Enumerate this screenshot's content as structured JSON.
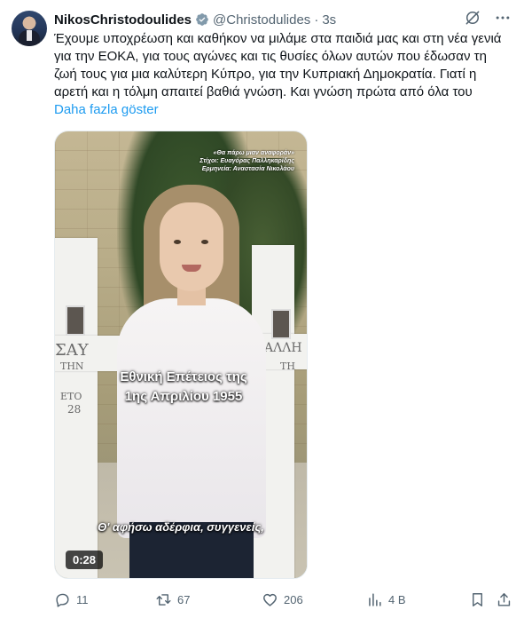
{
  "tweet": {
    "display_name": "NikosChristodoulides",
    "handle": "@Christodulides",
    "separator": "·",
    "time": "3s",
    "text_lines": [
      "Έχουμε υποχρέωση και καθήκον να μιλάμε στα παιδιά μας και στη νέα γενιά",
      "για την ΕΟΚΑ, για τους αγώνες και τις θυσίες όλων αυτών που έδωσαν τη",
      "ζωή τους για μια καλύτερη Κύπρο, για την Κυπριακή Δημοκρατία. Γιατί η",
      "αρετή και η τόλμη απαιτεί βαθιά γνώση. Και γνώση πρώτα από όλα του"
    ],
    "show_more": "Daha fazla göster"
  },
  "video": {
    "credits": [
      "«Θα πάρω μιαν αναφοράν»",
      "Στίχοι: Ευαγόρας Παλληκαρίδης",
      "Ερμηνεία: Αναστασία Νικολάου"
    ],
    "title_lines": [
      "Εθνική Επέτειος της",
      "1ης Απριλίου 1955"
    ],
    "subtitle": "Θ' αφήσω αδέρφια, συγγενείς,",
    "duration": "0:28",
    "cross_text_left": [
      "ΣΑΥ",
      "ΤΗΝ",
      "ΕΤΟ",
      "28"
    ],
    "cross_text_right": [
      "ΑΛΛΗ",
      "ΤΗ"
    ]
  },
  "actions": {
    "replies": "11",
    "reposts": "67",
    "likes": "206",
    "views": "4 B"
  },
  "icons": {
    "verified": "verified-badge-icon",
    "grok": "grok-icon",
    "more": "more-options-icon",
    "reply": "reply-icon",
    "repost": "repost-icon",
    "like": "heart-icon",
    "views": "views-chart-icon",
    "bookmark": "bookmark-icon",
    "share": "share-icon"
  },
  "colors": {
    "text": "#0f1419",
    "secondary": "#536471",
    "link": "#1d9bf0"
  }
}
